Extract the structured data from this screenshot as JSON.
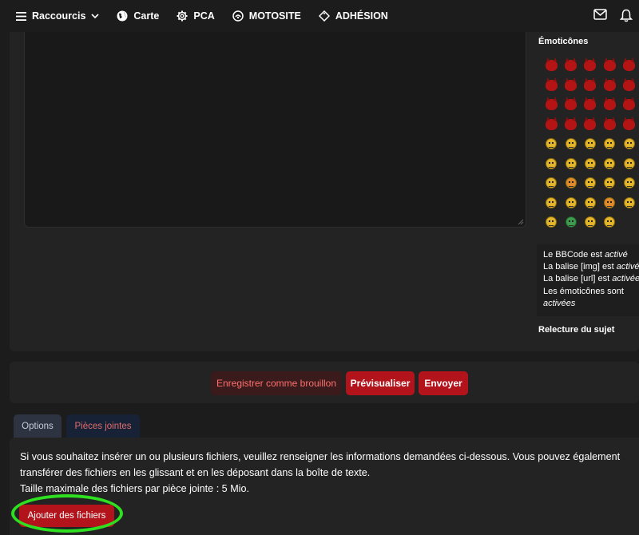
{
  "nav": {
    "shortcuts_label": "Raccourcis",
    "items": [
      {
        "label": "Carte",
        "icon": "globe-icon"
      },
      {
        "label": "PCA",
        "icon": "gear-icon"
      },
      {
        "label": "MOTOSITE",
        "icon": "moto-icon"
      },
      {
        "label": "ADHÉSION",
        "icon": "tag-icon"
      }
    ],
    "right_icons": [
      "mail-icon",
      "bell-icon"
    ]
  },
  "sidebar": {
    "emoticons_title": "Émoticônes",
    "bbcode": {
      "line1_prefix": "Le BBCode est ",
      "line1_value": "activé",
      "line2_prefix": "La balise [img] est ",
      "line2_value": "activée",
      "line3_prefix": "La balise [url] est ",
      "line3_value": "activée",
      "line4": "Les émoticônes sont",
      "line5_value": "activées"
    },
    "topic_review_title": "Relecture du sujet"
  },
  "actions": {
    "draft_label": "Enregistrer comme brouillon",
    "preview_label": "Prévisualiser",
    "send_label": "Envoyer"
  },
  "tabs": {
    "options_label": "Options",
    "attachments_label": "Pièces jointes"
  },
  "attachments": {
    "line1": "Si vous souhaitez insérer un ou plusieurs fichiers, veuillez renseigner les informations demandées ci-dessous. Vous pouvez également",
    "line2": "transférer des fichiers en les glissant et en les déposant dans la boîte de texte.",
    "line3": "Taille maximale des fichiers par pièce jointe : 5 Mio.",
    "add_files_label": "Ajouter des fichiers"
  },
  "colors": {
    "accent_red": "#b3141c",
    "highlight_green": "#2ee01f",
    "background": "#1c1c1c",
    "panel": "#232323"
  }
}
